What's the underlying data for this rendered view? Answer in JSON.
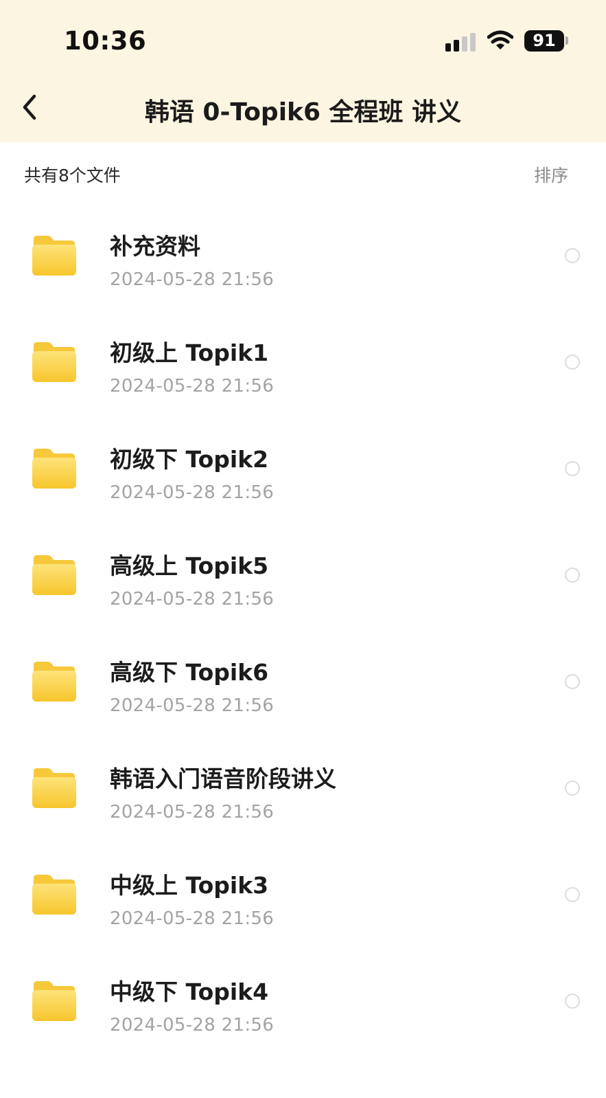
{
  "status_bar": {
    "time": "10:36",
    "battery": "91",
    "icons": [
      "signal-icon",
      "wifi-icon",
      "battery-icon"
    ]
  },
  "header": {
    "back_icon": "chevron-left-icon",
    "title": "韩语 0-Topik6 全程班 讲义"
  },
  "toolbar": {
    "file_count": "共有8个文件",
    "sort_label": "排序"
  },
  "colors": {
    "header_background": "#fcf5e1",
    "folder_yellow": "#f9cf38",
    "date_gray": "#a3a3a3"
  },
  "files": [
    {
      "name": "补充资料",
      "date": "2024-05-28 21:56",
      "icon": "folder-icon"
    },
    {
      "name": "初级上 Topik1",
      "date": "2024-05-28 21:56",
      "icon": "folder-icon"
    },
    {
      "name": "初级下 Topik2",
      "date": "2024-05-28 21:56",
      "icon": "folder-icon"
    },
    {
      "name": "高级上 Topik5",
      "date": "2024-05-28 21:56",
      "icon": "folder-icon"
    },
    {
      "name": "高级下 Topik6",
      "date": "2024-05-28 21:56",
      "icon": "folder-icon"
    },
    {
      "name": "韩语入门语音阶段讲义",
      "date": "2024-05-28 21:56",
      "icon": "folder-icon"
    },
    {
      "name": "中级上 Topik3",
      "date": "2024-05-28 21:56",
      "icon": "folder-icon"
    },
    {
      "name": "中级下 Topik4",
      "date": "2024-05-28 21:56",
      "icon": "folder-icon"
    }
  ]
}
